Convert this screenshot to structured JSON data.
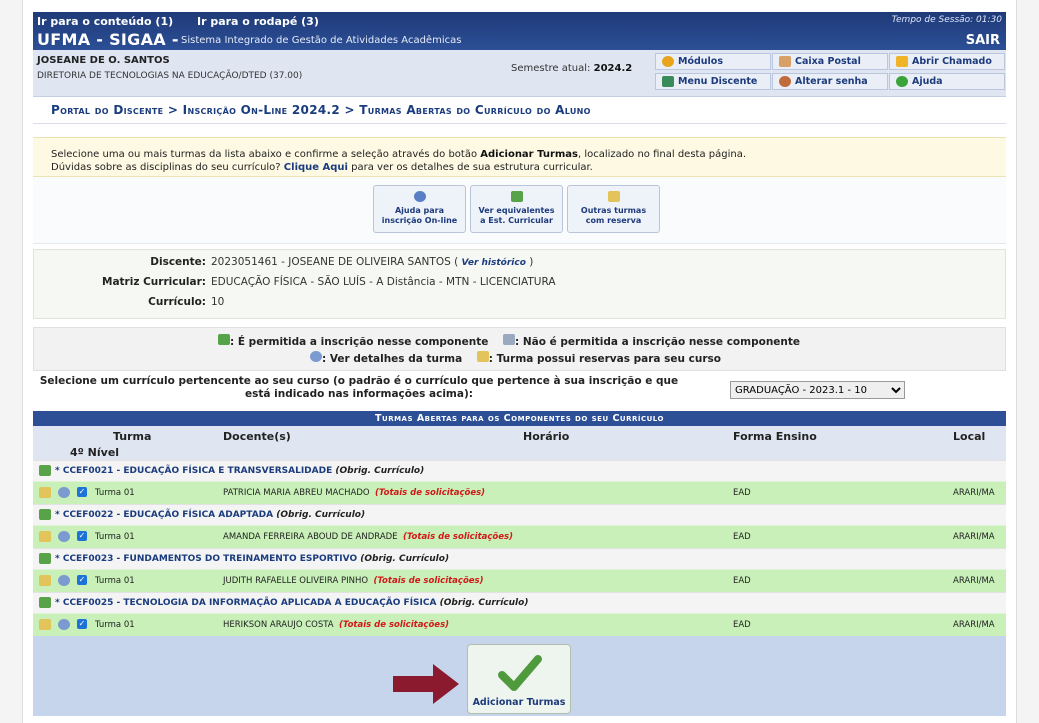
{
  "skip_links": [
    "Ir para o conteúdo (1)",
    "Ir para o rodapé (3)"
  ],
  "brand": "UFMA - SIGAA -",
  "brand_sub": "Sistema Integrado de Gestão de Atividades Acadêmicas",
  "session": "Tempo de Sessão: 01:30",
  "logout": "SAIR",
  "user": {
    "name": "JOSEANE DE O. SANTOS",
    "dept": "DIRETORIA DE TECNOLOGIAS NA EDUCAÇÃO/DTED (37.00)"
  },
  "semester_label": "Semestre atual:",
  "semester_value": "2024.2",
  "menu": {
    "modulos": "Módulos",
    "caixa": "Caixa Postal",
    "chamado": "Abrir Chamado",
    "discente": "Menu Discente",
    "senha": "Alterar senha",
    "ajuda": "Ajuda"
  },
  "breadcrumb": "Portal do Discente > Inscrição On-Line 2024.2 > Turmas Abertas do Currículo do Aluno",
  "note": {
    "line1_a": "Selecione uma ou mais turmas da lista abaixo e confirme a seleção através do botão ",
    "line1_b": "Adicionar Turmas",
    "line1_c": ", localizado no final desta página.",
    "line2_a": "Dúvidas sobre as disciplinas do seu currículo? ",
    "line2_link": "Clique Aqui",
    "line2_c": " para ver os detalhes de sua estrutura curricular."
  },
  "action_buttons": [
    {
      "label1": "Ajuda para",
      "label2": "inscrição On-line"
    },
    {
      "label1": "Ver equivalentes",
      "label2": "a Est. Curricular"
    },
    {
      "label1": "Outras turmas",
      "label2": "com reserva"
    }
  ],
  "info": {
    "discente_label": "Discente:",
    "discente_value": "2023051461 - JOSEANE DE OLIVEIRA SANTOS (",
    "historico_link": "Ver histórico",
    "discente_close": ")",
    "matriz_label": "Matriz Curricular:",
    "matriz_value": "EDUCAÇÃO FÍSICA - SÃO LUÍS - A Distância - MTN - LICENCIATURA",
    "curriculo_label": "Currículo:",
    "curriculo_value": "10"
  },
  "legend": {
    "allowed": ": É permitida a inscrição nesse componente",
    "denied": ": Não é permitida a inscrição nesse componente",
    "details": ": Ver detalhes da turma",
    "reserve": ": Turma possui reservas para seu curso"
  },
  "curriculum_prompt": "Selecione um currículo pertencente ao seu curso (o padrão é o currículo que pertence à sua inscrição e que está indicado nas informações acima):",
  "curriculum_selected": "GRADUAÇÃO - 2023.1 - 10",
  "table_title": "Turmas Abertas para os Componentes do seu Currículo",
  "columns": {
    "turma": "Turma",
    "docente": "Docente(s)",
    "horario": "Horário",
    "forma": "Forma Ensino",
    "local": "Local"
  },
  "level": "4º Nível",
  "components": [
    {
      "title": "* CCEF0021 - EDUCAÇÃO FÍSICA E TRANSVERSALIDADE",
      "tag": "(Obrig. Currículo)",
      "turma": "Turma 01",
      "docente": "PATRICIA MARIA ABREU MACHADO",
      "req": "(Totais de solicitações)",
      "forma": "EAD",
      "local": "ARARI/MA"
    },
    {
      "title": "* CCEF0022 - EDUCAÇÃO FÍSICA ADAPTADA",
      "tag": "(Obrig. Currículo)",
      "turma": "Turma 01",
      "docente": "AMANDA FERREIRA ABOUD DE ANDRADE",
      "req": "(Totais de solicitações)",
      "forma": "EAD",
      "local": "ARARI/MA"
    },
    {
      "title": "* CCEF0023 - FUNDAMENTOS DO TREINAMENTO ESPORTIVO",
      "tag": "(Obrig. Currículo)",
      "turma": "Turma 01",
      "docente": "JUDITH RAFAELLE OLIVEIRA PINHO",
      "req": "(Totais de solicitações)",
      "forma": "EAD",
      "local": "ARARI/MA"
    },
    {
      "title": "* CCEF0025 - TECNOLOGIA DA INFORMAÇÃO APLICADA A EDUCAÇÃO FÍSICA",
      "tag": "(Obrig. Currículo)",
      "turma": "Turma 01",
      "docente": "HERIKSON ARAUJO COSTA",
      "req": "(Totais de solicitações)",
      "forma": "EAD",
      "local": "ARARI/MA"
    }
  ],
  "add_button": "Adicionar Turmas",
  "colors": {
    "header": "#2c4f96",
    "row_green": "#c8f0b8",
    "arrow": "#8b1a2e"
  }
}
